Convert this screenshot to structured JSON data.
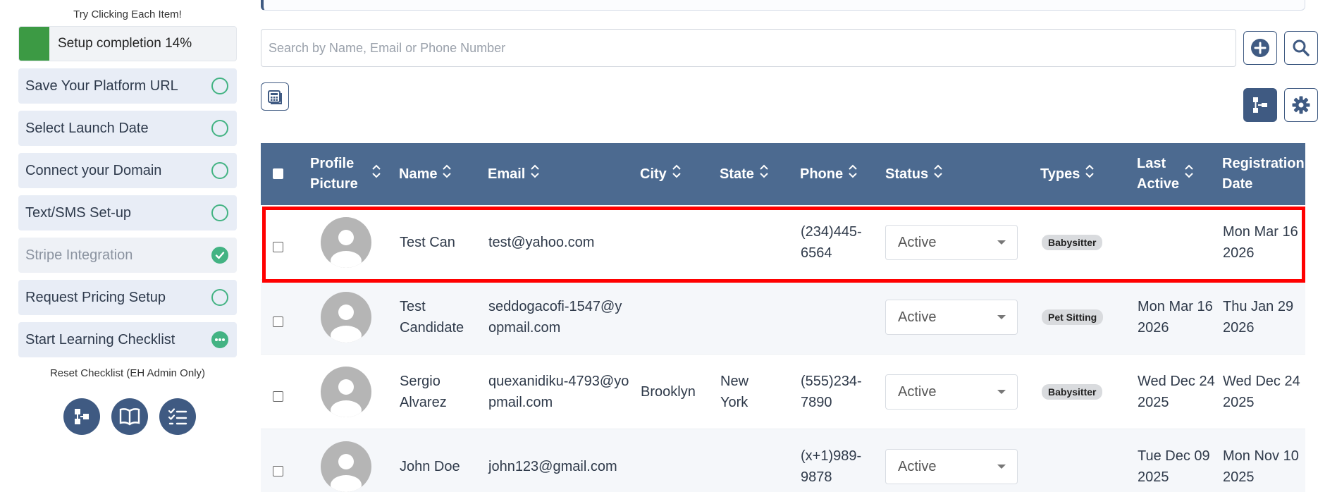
{
  "sidebar": {
    "hint": "Try Clicking Each Item!",
    "progress_label": "Setup completion 14%",
    "progress_percent": 14,
    "items": [
      {
        "label": "Save Your Platform URL",
        "state": "open"
      },
      {
        "label": "Select Launch Date",
        "state": "open"
      },
      {
        "label": "Connect your Domain",
        "state": "open"
      },
      {
        "label": "Text/SMS Set-up",
        "state": "open"
      },
      {
        "label": "Stripe Integration",
        "state": "done"
      },
      {
        "label": "Request Pricing Setup",
        "state": "open"
      },
      {
        "label": "Start Learning Checklist",
        "state": "in-progress"
      }
    ],
    "reset_label": "Reset Checklist (EH Admin Only)",
    "icons": [
      "sitemap-icon",
      "book-open-icon",
      "checklist-icon"
    ]
  },
  "search": {
    "placeholder": "Search by Name, Email or Phone Number"
  },
  "toolbar": {
    "icons": [
      "plus-circle-icon",
      "search-icon",
      "calculator-icon",
      "sitemap-icon",
      "gear-icon"
    ]
  },
  "table": {
    "headers": {
      "profile_picture": "Profile Picture",
      "name": "Name",
      "email": "Email",
      "city": "City",
      "state": "State",
      "phone": "Phone",
      "status": "Status",
      "types": "Types",
      "last_active": "Last Active",
      "registration_date": "Registration Date"
    },
    "rows": [
      {
        "name": "Test Can",
        "email": "test@yahoo.com",
        "city": "",
        "state": "",
        "phone": "(234)445-6564",
        "status": "Active",
        "type": "Babysitter",
        "last_active": "",
        "registration_date": "Mon Mar 16 2026"
      },
      {
        "name": "Test Candidate",
        "email": "seddogacofi-1547@yopmail.com",
        "city": "",
        "state": "",
        "phone": "",
        "status": "Active",
        "type": "Pet Sitting",
        "last_active": "Mon Mar 16 2026",
        "registration_date": "Thu Jan 29 2026"
      },
      {
        "name": "Sergio Alvarez",
        "email": "quexanidiku-4793@yopmail.com",
        "city": "Brooklyn",
        "state": "New York",
        "phone": "(555)234-7890",
        "status": "Active",
        "type": "Babysitter",
        "last_active": "Wed Dec 24 2025",
        "registration_date": "Wed Dec 24 2025"
      },
      {
        "name": "John Doe",
        "email": "john123@gmail.com",
        "city": "",
        "state": "",
        "phone": "(x+1)989-9878",
        "status": "Active",
        "type": "",
        "last_active": "Tue Dec 09 2025",
        "registration_date": "Mon Nov 10 2025"
      }
    ]
  },
  "colors": {
    "accent": "#3f5a82",
    "header_bg": "#4c6a90",
    "progress": "#3c9a44",
    "check_ring": "#43b383",
    "highlight": "#ff0000"
  }
}
